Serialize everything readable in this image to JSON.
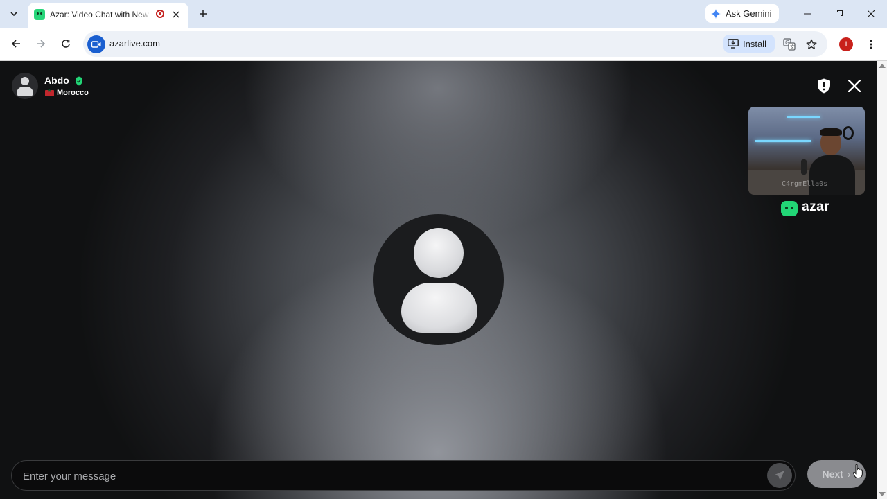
{
  "browser": {
    "tab": {
      "title": "Azar: Video Chat with New Friends",
      "close_icon": "close-icon"
    },
    "ask_gemini": "Ask Gemini",
    "address": "azarlive.com",
    "install_label": "Install",
    "profile_initial": "I"
  },
  "peer": {
    "name": "Abdo",
    "country": "Morocco",
    "verified": true
  },
  "self_view": {
    "overlay_text": "C4rgmElla0s"
  },
  "brand": {
    "name": "azar"
  },
  "chat": {
    "placeholder": "Enter your message",
    "value": ""
  },
  "next_button": {
    "label": "Next",
    "arrow": "›"
  },
  "colors": {
    "brand_green": "#22d676",
    "tab_strip": "#dce6f4",
    "stage_dark": "#101112"
  }
}
